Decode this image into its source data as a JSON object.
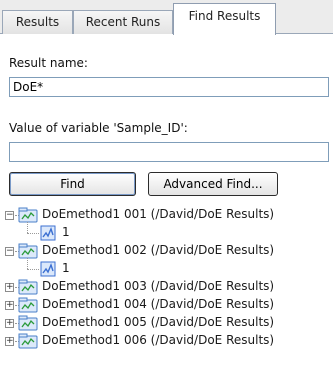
{
  "tabs": [
    {
      "label": "Results"
    },
    {
      "label": "Recent Runs"
    },
    {
      "label": "Find Results",
      "active": true
    }
  ],
  "form": {
    "result_name_label": "Result name:",
    "result_name_value": "DoE*",
    "variable_label": "Value of variable 'Sample_ID':",
    "variable_value": ""
  },
  "buttons": {
    "find": "Find",
    "advanced_find": "Advanced Find..."
  },
  "tree": {
    "nodes": [
      {
        "label": "DoEmethod1 001  (/David/DoE Results)",
        "expanded": true,
        "child": "1"
      },
      {
        "label": "DoEmethod1 002  (/David/DoE Results)",
        "expanded": true,
        "child": "1"
      },
      {
        "label": "DoEmethod1 003  (/David/DoE Results)",
        "expanded": false
      },
      {
        "label": "DoEmethod1 004  (/David/DoE Results)",
        "expanded": false
      },
      {
        "label": "DoEmethod1 005  (/David/DoE Results)",
        "expanded": false
      },
      {
        "label": "DoEmethod1 006  (/David/DoE Results)",
        "expanded": false
      }
    ]
  },
  "colors": {
    "folder_icon": "#4a7fc8",
    "result_icon": "#3b6fd1"
  }
}
